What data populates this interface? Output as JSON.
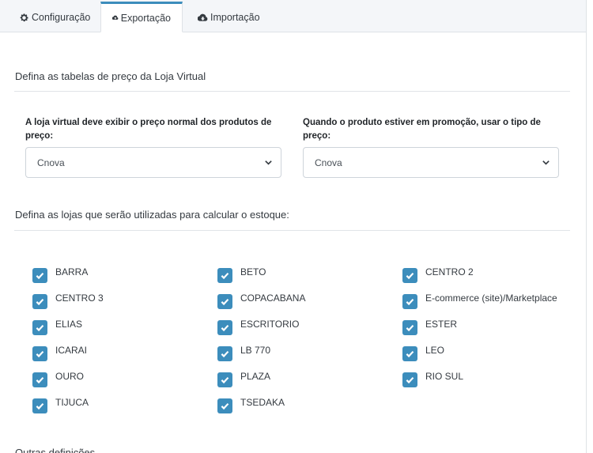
{
  "tabs": [
    {
      "label": "Configuração",
      "icon": "gear-icon"
    },
    {
      "label": "Exportação",
      "icon": "cloud-upload-icon",
      "active": true
    },
    {
      "label": "Importação",
      "icon": "cloud-download-icon"
    }
  ],
  "price_section": {
    "title": "Defina as tabelas de preço da Loja Virtual",
    "normal_price": {
      "label": "A loja virtual deve exibir o preço normal dos produtos de preço:",
      "value": "Cnova"
    },
    "promo_price": {
      "label": "Quando o produto estiver em promoção, usar o tipo de preço:",
      "value": "Cnova"
    }
  },
  "stock_section": {
    "title": "Defina as lojas que serão utilizadas para calcular o estoque:",
    "stores": [
      {
        "label": "BARRA",
        "checked": true
      },
      {
        "label": "BETO",
        "checked": true
      },
      {
        "label": "CENTRO 2",
        "checked": true
      },
      {
        "label": "CENTRO 3",
        "checked": true
      },
      {
        "label": "COPACABANA",
        "checked": true
      },
      {
        "label": "E-commerce (site)/Marketplace",
        "checked": true
      },
      {
        "label": "ELIAS",
        "checked": true
      },
      {
        "label": "ESCRITORIO",
        "checked": true
      },
      {
        "label": "ESTER",
        "checked": true
      },
      {
        "label": "ICARAI",
        "checked": true
      },
      {
        "label": "LB 770",
        "checked": true
      },
      {
        "label": "LEO",
        "checked": true
      },
      {
        "label": "OURO",
        "checked": true
      },
      {
        "label": "PLAZA",
        "checked": true
      },
      {
        "label": "RIO SUL",
        "checked": true
      },
      {
        "label": "TIJUCA",
        "checked": true
      },
      {
        "label": "TSEDAKA",
        "checked": true
      }
    ]
  },
  "other_section": {
    "title": "Outras definições"
  },
  "colors": {
    "accent": "#3c8dbc",
    "tab_bg": "#f4f6f9",
    "border": "#dee2e6"
  }
}
